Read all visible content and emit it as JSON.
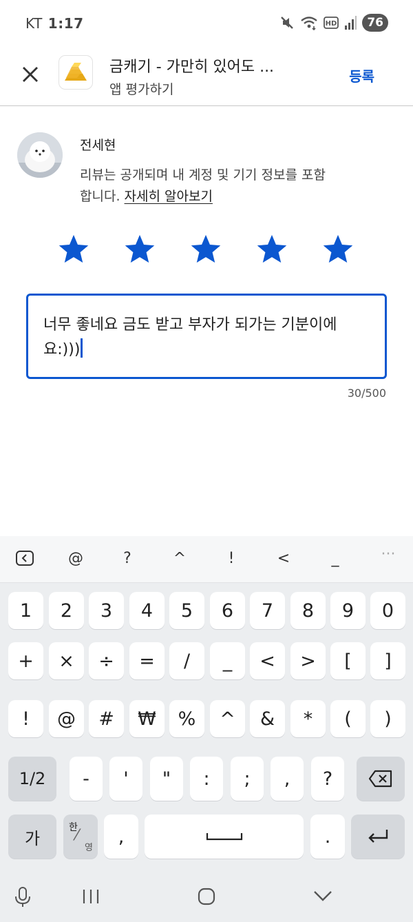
{
  "status_bar": {
    "carrier": "KT",
    "time": "1:17",
    "battery": "76"
  },
  "app_bar": {
    "close_icon": "close-icon",
    "app_name": "금캐기 - 가만히 있어도 ...",
    "subtitle": "앱 평가하기",
    "post_label": "등록",
    "accent_color": "#0b57d0"
  },
  "user": {
    "name": "전세현",
    "notice": "리뷰는 공개되며 내 계정 및 기기 정보를 포함합니다. ",
    "learn_more": "자세히 알아보기"
  },
  "rating": {
    "value": 5,
    "max": 5,
    "star_color": "#0b57d0"
  },
  "review": {
    "text": "너무 좋네요 금도 받고 부자가 되가는 기분이에요:)))",
    "char_count": "30/500"
  },
  "keyboard": {
    "toolbar": [
      "@",
      "?",
      "^",
      "!",
      "<",
      "_"
    ],
    "rows": [
      [
        "1",
        "2",
        "3",
        "4",
        "5",
        "6",
        "7",
        "8",
        "9",
        "0"
      ],
      [
        "+",
        "×",
        "÷",
        "=",
        "/",
        "_",
        "<",
        ">",
        "[",
        "]"
      ],
      [
        "!",
        "@",
        "#",
        "₩",
        "%",
        "^",
        "&",
        "*",
        "(",
        ")"
      ]
    ],
    "row4": {
      "shift": "1/2",
      "keys": [
        "-",
        "'",
        "\"",
        ":",
        ";",
        ",",
        "?"
      ]
    },
    "row5": {
      "lang_key": "가",
      "han": "한",
      "yeong": "영",
      "comma": ",",
      "period": "."
    }
  }
}
